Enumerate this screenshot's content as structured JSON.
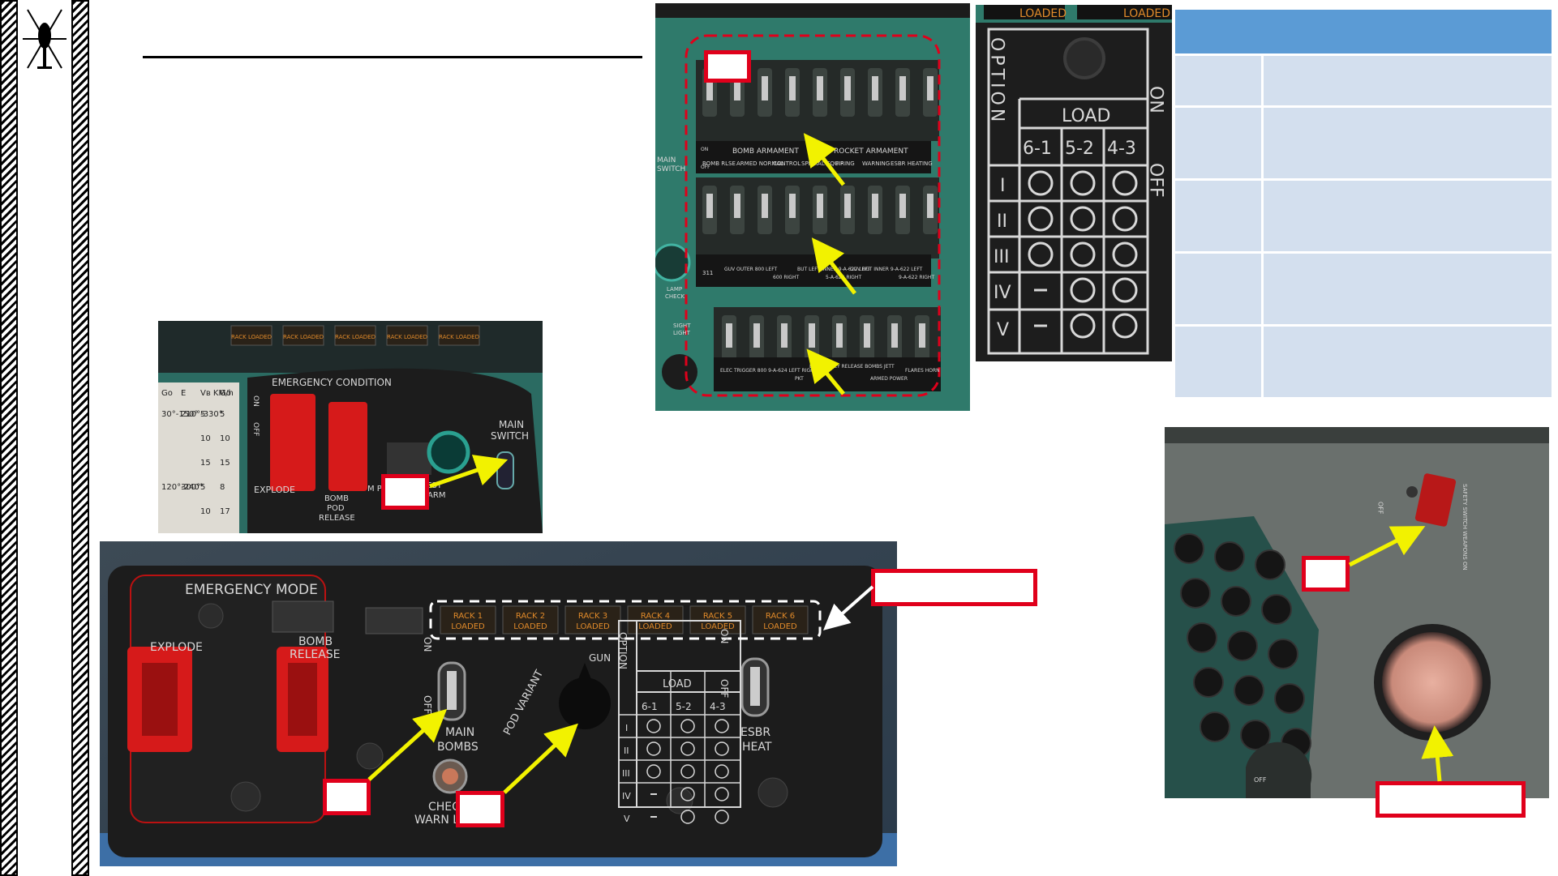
{
  "bomb_panel": {
    "emergency_mode": "EMERGENCY MODE",
    "explode": "EXPLODE",
    "bomb_release_1": "BOMB",
    "bomb_release_2": "RELEASE",
    "rack_lights": [
      {
        "line1": "RACK 1",
        "line2": "LOADED"
      },
      {
        "line1": "RACK 2",
        "line2": "LOADED"
      },
      {
        "line1": "RACK 3",
        "line2": "LOADED"
      },
      {
        "line1": "RACK 4",
        "line2": "LOADED"
      },
      {
        "line1": "RACK 5",
        "line2": "LOADED"
      },
      {
        "line1": "RACK 6",
        "line2": "LOADED"
      }
    ],
    "main_bombs_1": "MAIN",
    "main_bombs_2": "BOMBS",
    "on": "ON",
    "off": "OFF",
    "check_warn_1": "CHECK",
    "check_warn_2": "WARN L",
    "pod_variant": "POD VARIANT",
    "gun": "GUN",
    "option": "OPTION",
    "load": "LOAD",
    "esbr_heat_1": "ESBR",
    "esbr_heat_2": "HEAT",
    "load_columns": [
      "6-1",
      "5-2",
      "4-3"
    ],
    "load_rows": [
      "I",
      "II",
      "III",
      "IV",
      "V"
    ]
  },
  "emergency_panel": {
    "title": "EMERGENCY CONDITION",
    "main_switch_1": "MAIN",
    "main_switch_2": "SWITCH",
    "explode": "EXPLODE",
    "bomb_pod_release_1": "BOMB",
    "bomb_pod_release_2": "POD",
    "bomb_pod_release_3": "RELEASE",
    "test_unit_arm_1": "TEST",
    "test_unit_arm_2": "UNIT ARM",
    "power_fragment": "M POW",
    "rack_lights": [
      "RACK LOADED",
      "RACK LOADED",
      "RACK LOADED",
      "RACK LOADED",
      "RACK LOADED"
    ],
    "table_header": [
      "Go",
      "E",
      "Vв KM/h",
      "Go"
    ],
    "table_rows": [
      [
        "30°-150°",
        "210°-330°",
        "5",
        "5"
      ],
      [
        "",
        "",
        "10",
        "10"
      ],
      [
        "",
        "",
        "15",
        "15"
      ],
      [
        "120°-240°",
        "300°",
        "5",
        "8"
      ],
      [
        "",
        "",
        "10",
        "17"
      ]
    ],
    "on": "ON",
    "off": "OFF"
  },
  "armament_panel": {
    "main_switch_1": "MAIN",
    "main_switch_2": "SWITCH",
    "lamp_check_1": "LAMP",
    "lamp_check_2": "CHECK",
    "sight_light_1": "SIGHT",
    "sight_light_2": "LIGHT",
    "row1_groups": [
      "BOMB ARMAMENT",
      "ROCKET ARMAMENT"
    ],
    "row1_labels": [
      "BOMB RLSE",
      "ARMED NORMAL",
      "CONTROL",
      "SPECIAL EQUIP",
      "FIRING",
      "WARNING",
      "ESBR HEATING"
    ],
    "row2_labels": [
      "311",
      "GUV OUTER 800 LEFT",
      "600 RIGHT",
      "BUT LEFT INNER 9-A-622 LEFT",
      "5-A-622 RIGHT",
      "GUV RGT INNER 9-A-622 LEFT",
      "9-A-622 RIGHT"
    ],
    "row3_labels": [
      "ELEC TRIGGER 800 9-A-624 LEFT RIGHT",
      "PKT",
      "EMERGENCY RELEASE BOMBS JETT",
      "ARMED POWER",
      "FLARES HORN"
    ],
    "on": "ON",
    "off": "OFF"
  },
  "option_panel": {
    "loaded_1": "LOADED",
    "loaded_2": "LOADED",
    "option": "OPTION",
    "load": "LOAD",
    "on": "ON",
    "off": "OFF",
    "columns": [
      "6-1",
      "5-2",
      "4-3"
    ],
    "rows": [
      "I",
      "II",
      "III",
      "IV",
      "V"
    ]
  },
  "safety_panel": {
    "switch_label": "SAFETY SWITCH WEAPONS ON",
    "off": "OFF",
    "dial_off": "OFF"
  },
  "colors": {
    "callout_red": "#e0001b",
    "arrow_yellow": "#f2f200",
    "table_header": "#5b9bd5",
    "table_cell": "#d3dfee",
    "panel_teal": "#2e6f63",
    "panel_black": "#1b1b1b",
    "rack_amber": "#e08a2a"
  }
}
